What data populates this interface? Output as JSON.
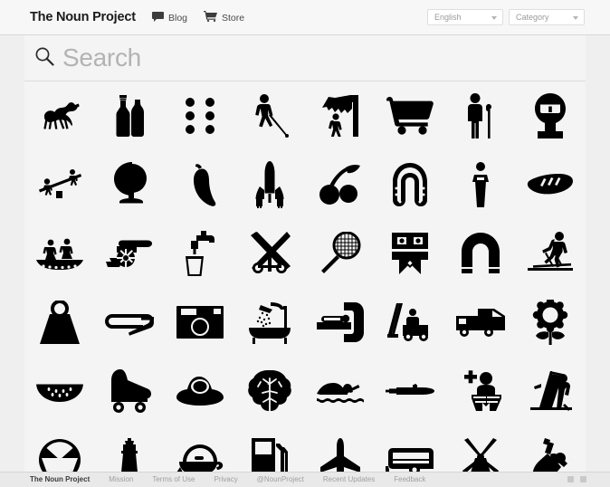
{
  "header": {
    "logo": "The Noun Project",
    "nav": [
      {
        "label": "Blog",
        "icon": "speech-bubble-icon"
      },
      {
        "label": "Store",
        "icon": "shopping-cart-icon"
      }
    ],
    "selects": [
      {
        "name": "language-select",
        "value": "English"
      },
      {
        "name": "category-select",
        "value": "Category"
      }
    ]
  },
  "search": {
    "icon": "search-icon",
    "placeholder": "Search",
    "value": ""
  },
  "grid": {
    "columns": 8,
    "rows": 6,
    "icons": [
      {
        "name": "camel-icon",
        "label": "Camel"
      },
      {
        "name": "bottles-icon",
        "label": "Bottles"
      },
      {
        "name": "braille-dots-icon",
        "label": "Braille"
      },
      {
        "name": "blind-person-icon",
        "label": "Blind Person"
      },
      {
        "name": "rockfall-warning-icon",
        "label": "Falling Rocks"
      },
      {
        "name": "shopping-cart-icon",
        "label": "Shopping Cart"
      },
      {
        "name": "elderly-person-icon",
        "label": "Elderly"
      },
      {
        "name": "parking-meter-icon",
        "label": "Parking Meter"
      },
      {
        "name": "seesaw-icon",
        "label": "Seesaw"
      },
      {
        "name": "globe-icon",
        "label": "Globe"
      },
      {
        "name": "chili-pepper-icon",
        "label": "Chili Pepper"
      },
      {
        "name": "space-shuttle-icon",
        "label": "Space Shuttle"
      },
      {
        "name": "cherries-icon",
        "label": "Cherries"
      },
      {
        "name": "horseshoe-icon",
        "label": "Horseshoe"
      },
      {
        "name": "standing-figure-icon",
        "label": "Person"
      },
      {
        "name": "baguette-icon",
        "label": "Baguette"
      },
      {
        "name": "canoe-icon",
        "label": "Canoe"
      },
      {
        "name": "cannon-icon",
        "label": "Cannon"
      },
      {
        "name": "faucet-glass-icon",
        "label": "Drinking Water"
      },
      {
        "name": "railroad-crossing-icon",
        "label": "Railroad Crossing"
      },
      {
        "name": "badminton-racket-icon",
        "label": "Badminton"
      },
      {
        "name": "mask-face-icon",
        "label": "Mask"
      },
      {
        "name": "magnet-icon",
        "label": "Magnet"
      },
      {
        "name": "cross-country-skier-icon",
        "label": "Cross Country Skiing"
      },
      {
        "name": "weight-icon",
        "label": "Weight"
      },
      {
        "name": "safety-pin-icon",
        "label": "Safety Pin"
      },
      {
        "name": "camera-icon",
        "label": "Camera"
      },
      {
        "name": "bathtub-shower-icon",
        "label": "Bathtub"
      },
      {
        "name": "mri-scanner-icon",
        "label": "MRI Scanner"
      },
      {
        "name": "forklift-icon",
        "label": "Forklift"
      },
      {
        "name": "garbage-truck-icon",
        "label": "Garbage Truck"
      },
      {
        "name": "sunflower-icon",
        "label": "Sunflower"
      },
      {
        "name": "watermelon-icon",
        "label": "Watermelon"
      },
      {
        "name": "roller-skate-icon",
        "label": "Roller Skate"
      },
      {
        "name": "fried-egg-icon",
        "label": "Fried Egg"
      },
      {
        "name": "brain-icon",
        "label": "Brain"
      },
      {
        "name": "swimmer-icon",
        "label": "Swimmer"
      },
      {
        "name": "submarine-icon",
        "label": "Submarine"
      },
      {
        "name": "add-person-reading-icon",
        "label": "Add Reader"
      },
      {
        "name": "easel-painter-icon",
        "label": "Painter"
      },
      {
        "name": "fallout-shelter-icon",
        "label": "Fallout Shelter"
      },
      {
        "name": "lighthouse-icon",
        "label": "Lighthouse"
      },
      {
        "name": "teapot-icon",
        "label": "Teapot"
      },
      {
        "name": "gas-pump-icon",
        "label": "Gas Pump"
      },
      {
        "name": "airplane-icon",
        "label": "Airplane"
      },
      {
        "name": "camper-trailer-icon",
        "label": "Camper Trailer"
      },
      {
        "name": "windmill-icon",
        "label": "Windmill"
      },
      {
        "name": "kayaker-icon",
        "label": "Kayaker"
      }
    ]
  },
  "footer": {
    "brand": "The Noun Project",
    "links": [
      "Mission",
      "Terms of Use",
      "Privacy",
      "@NounProject",
      "Recent Updates",
      "Feedback"
    ]
  },
  "colors": {
    "page_bg": "#efefef",
    "content_bg": "#f4f4f4",
    "header_bg": "#f7f7f7",
    "icon_fill": "#000000",
    "placeholder": "#b3b3b3"
  }
}
